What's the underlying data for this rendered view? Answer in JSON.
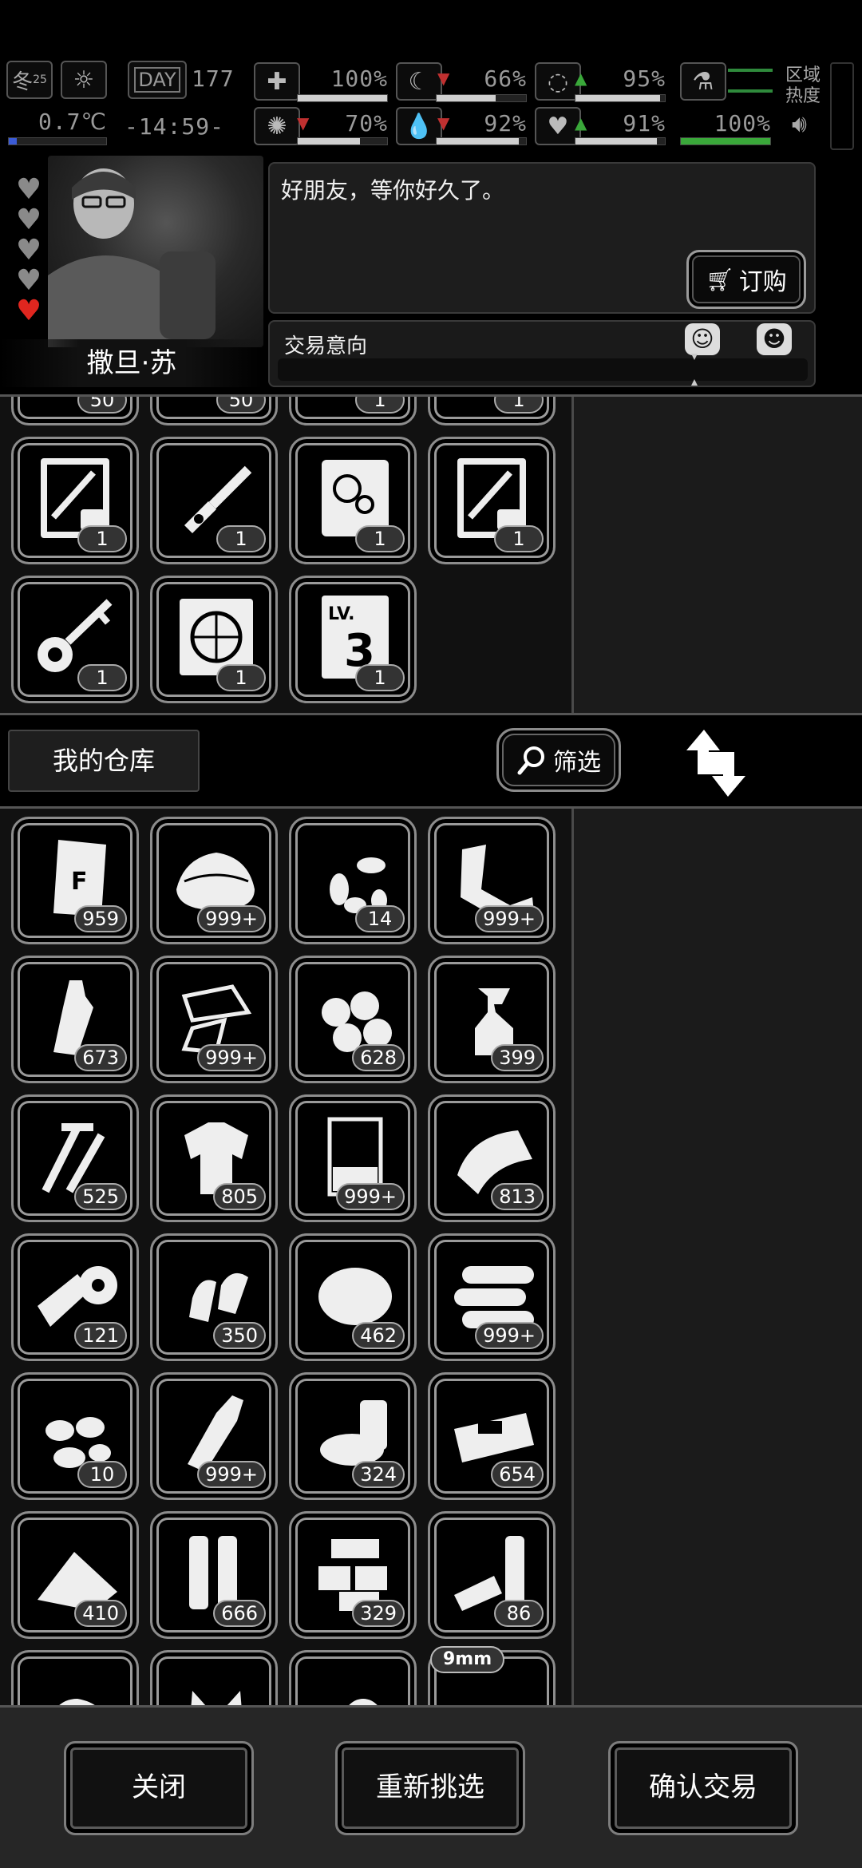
{
  "status": {
    "season": "冬",
    "season_day": "25",
    "temperature": "0.7℃",
    "day_label": "DAY",
    "day_value": "177",
    "time": "-14:59-",
    "region_label_1": "区域",
    "region_label_2": "热度",
    "stats": [
      {
        "name": "health",
        "value": "100%",
        "fill": 1.0
      },
      {
        "name": "hunger",
        "value": "66%",
        "fill": 0.66
      },
      {
        "name": "fatigue",
        "value": "95%",
        "fill": 0.95
      },
      {
        "name": "virus",
        "value": "70%",
        "fill": 0.7
      },
      {
        "name": "thirst",
        "value": "92%",
        "fill": 0.92
      },
      {
        "name": "mood",
        "value": "91%",
        "fill": 0.91
      },
      {
        "name": "region",
        "value": "100%",
        "fill": 1.0
      }
    ]
  },
  "npc": {
    "name": "撒旦·苏",
    "dialog": "好朋友，等你好久了。",
    "order_label": "订购",
    "trade_intent_label": "交易意向",
    "trade_intent_level": 0.54,
    "hearts_total": 5,
    "hearts_active": 1
  },
  "merchant_items": [
    {
      "icon": "item-icon",
      "count": "50"
    },
    {
      "icon": "item-icon",
      "count": "50"
    },
    {
      "icon": "item-icon",
      "count": "1"
    },
    {
      "icon": "item-icon",
      "count": "1"
    },
    {
      "icon": "blueprint-weapon-icon",
      "count": "1"
    },
    {
      "icon": "car-key-icon",
      "count": "1"
    },
    {
      "icon": "map-scroll-icon",
      "count": "1"
    },
    {
      "icon": "blueprint-weapon-icon",
      "count": "1"
    },
    {
      "icon": "key-icon",
      "count": "1"
    },
    {
      "icon": "blueprint-wheel-icon",
      "count": "1"
    },
    {
      "icon": "level-book-icon",
      "count": "1",
      "art": "LV. 3"
    }
  ],
  "warehouse": {
    "label": "我的仓库",
    "filter_label": "筛选",
    "items": [
      {
        "icon": "flour-bag-icon",
        "count": "959"
      },
      {
        "icon": "cloth-pile-icon",
        "count": "999+"
      },
      {
        "icon": "seeds-icon",
        "count": "14"
      },
      {
        "icon": "scrap-metal-icon",
        "count": "999+"
      },
      {
        "icon": "plastic-bottle-icon",
        "count": "673"
      },
      {
        "icon": "glass-shards-icon",
        "count": "999+"
      },
      {
        "icon": "cotton-balls-icon",
        "count": "628"
      },
      {
        "icon": "spray-bottle-icon",
        "count": "399"
      },
      {
        "icon": "screws-icon",
        "count": "525"
      },
      {
        "icon": "rag-shirt-icon",
        "count": "805"
      },
      {
        "icon": "beaker-icon",
        "count": "999+"
      },
      {
        "icon": "towel-icon",
        "count": "813"
      },
      {
        "icon": "bandage-roll-icon",
        "count": "121"
      },
      {
        "icon": "bullets-icon",
        "count": "350"
      },
      {
        "icon": "fur-icon",
        "count": "462"
      },
      {
        "icon": "logs-icon",
        "count": "999+"
      },
      {
        "icon": "nuts-icon",
        "count": "10"
      },
      {
        "icon": "glass-bottle-icon",
        "count": "999+"
      },
      {
        "icon": "cans-icon",
        "count": "324"
      },
      {
        "icon": "ammo-box-icon",
        "count": "654"
      },
      {
        "icon": "powder-pile-icon",
        "count": "410"
      },
      {
        "icon": "shell-casings-icon",
        "count": "666"
      },
      {
        "icon": "bricks-icon",
        "count": "329"
      },
      {
        "icon": "batteries-icon",
        "count": "86"
      },
      {
        "icon": "rock-icon",
        "count": ""
      },
      {
        "icon": "cat-icon",
        "count": ""
      },
      {
        "icon": "egg-icon",
        "count": ""
      },
      {
        "icon": "9mm-ammo-icon",
        "count": "",
        "tag": "9mm"
      }
    ]
  },
  "footer": {
    "close_label": "关闭",
    "reselect_label": "重新挑选",
    "confirm_label": "确认交易"
  }
}
